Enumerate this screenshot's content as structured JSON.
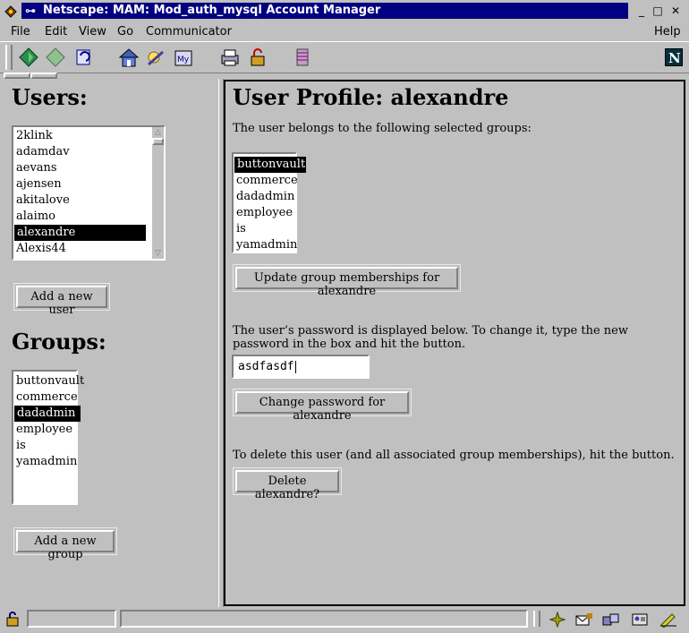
{
  "window": {
    "title": "Netscape: MAM: Mod_auth_mysql Account Manager"
  },
  "menu": [
    "File",
    "Edit",
    "View",
    "Go",
    "Communicator",
    "Help"
  ],
  "toolbar_icons": [
    "back-icon",
    "forward-icon",
    "reload-icon",
    "home-icon",
    "search-icon",
    "my-netscape-icon",
    "print-icon",
    "security-icon",
    "stop-icon"
  ],
  "left": {
    "users_heading": "Users:",
    "users": [
      "2klink",
      "adamdav",
      "aevans",
      "ajensen",
      "akitalove",
      "alaimo",
      "alexandre",
      "Alexis44"
    ],
    "selected_user": "alexandre",
    "add_user_label": "Add a new user",
    "groups_heading": "Groups:",
    "groups": [
      "buttonvault",
      "commerce",
      "dadadmin",
      "employee",
      "is",
      "yamadmin"
    ],
    "selected_group": "dadadmin",
    "add_group_label": "Add a new group"
  },
  "profile": {
    "heading": "User Profile: alexandre",
    "groups_intro": "The user belongs to the following selected groups:",
    "groups": [
      "buttonvault",
      "commerce",
      "dadadmin",
      "employee",
      "is",
      "yamadmin"
    ],
    "selected_group": "buttonvault",
    "update_label": "Update group memberships for alexandre",
    "password_intro": "The user’s password is displayed below. To change it, type the new password in the box and hit the button.",
    "password_value": "asdfasdf",
    "change_password_label": "Change password for alexandre",
    "delete_intro": "To delete this user (and all associated group memberships), hit the button.",
    "delete_label": "Delete alexandre?"
  },
  "colors": {
    "title_bar": "#000080",
    "chrome": "#c0c0c0",
    "selection": "#000000"
  }
}
